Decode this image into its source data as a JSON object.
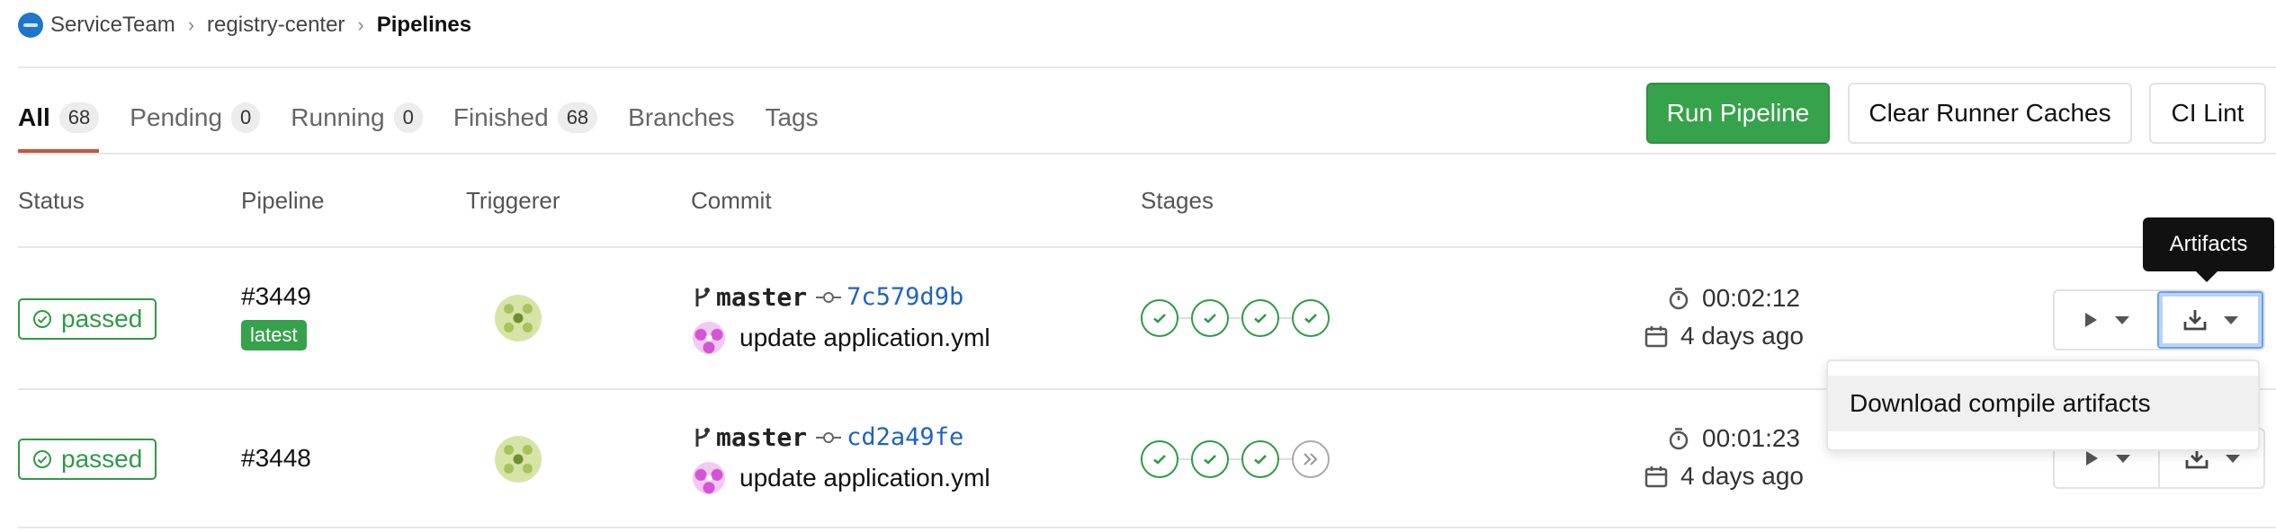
{
  "breadcrumb": {
    "items": [
      "ServiceTeam",
      "registry-center",
      "Pipelines"
    ],
    "separator": "›"
  },
  "tabs": [
    {
      "label": "All",
      "count": "68",
      "active": true
    },
    {
      "label": "Pending",
      "count": "0"
    },
    {
      "label": "Running",
      "count": "0"
    },
    {
      "label": "Finished",
      "count": "68"
    },
    {
      "label": "Branches"
    },
    {
      "label": "Tags"
    }
  ],
  "toolbar": {
    "run_pipeline": "Run Pipeline",
    "clear_caches": "Clear Runner Caches",
    "ci_lint": "CI Lint"
  },
  "columns": {
    "status": "Status",
    "pipeline": "Pipeline",
    "triggerer": "Triggerer",
    "commit": "Commit",
    "stages": "Stages"
  },
  "pipelines": [
    {
      "status": "passed",
      "id": "#3449",
      "tag": "latest",
      "branch": "master",
      "sha": "7c579d9b",
      "message": "update application.yml",
      "stages": [
        "success",
        "success",
        "success",
        "success"
      ],
      "duration": "00:02:12",
      "finished": "4 days ago"
    },
    {
      "status": "passed",
      "id": "#3448",
      "tag": "",
      "branch": "master",
      "sha": "cd2a49fe",
      "message": "update application.yml",
      "stages": [
        "success",
        "success",
        "success",
        "skipped"
      ],
      "duration": "00:01:23",
      "finished": "4 days ago"
    }
  ],
  "tooltip": "Artifacts",
  "artifacts_menu": {
    "items": [
      "Download compile artifacts"
    ]
  },
  "icons": {
    "status": "check-circle-icon",
    "branch": "branch-icon",
    "commit": "commit-icon",
    "duration": "stopwatch-icon",
    "finished": "calendar-icon",
    "play": "play-icon",
    "download": "download-icon",
    "stage_success": "check-icon",
    "stage_skipped": "skipped-icon"
  },
  "colors": {
    "success": "#2f9b47",
    "primary_button": "#36a24b",
    "sha_link": "#1f63c2",
    "active_tab_underline": "#c1593b"
  }
}
